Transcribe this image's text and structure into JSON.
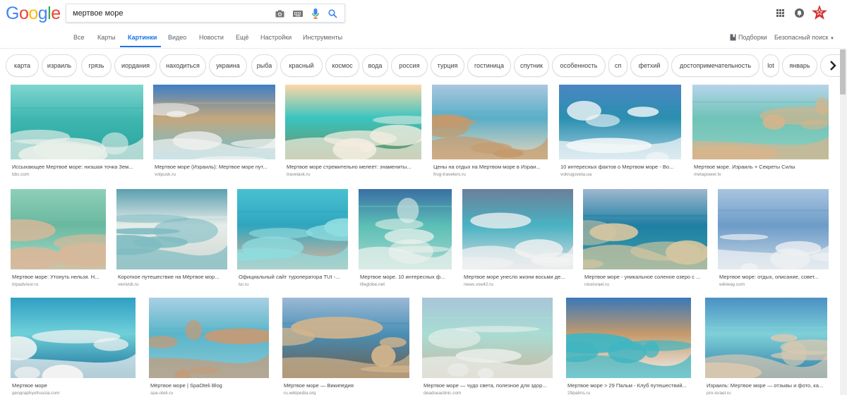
{
  "logo": {
    "letters": [
      "G",
      "o",
      "o",
      "g",
      "l",
      "e"
    ],
    "colors": [
      "#4285f4",
      "#ea4335",
      "#fbbc05",
      "#4285f4",
      "#34a853",
      "#ea4335"
    ]
  },
  "search": {
    "value": "мертвое море",
    "placeholder": ""
  },
  "icons": {
    "camera": "camera-icon",
    "keyboard": "keyboard-icon",
    "mic": "mic-icon",
    "search": "search-icon",
    "apps": "apps-grid-icon",
    "notifications": "notifications-icon",
    "profile": "star-profile-icon"
  },
  "nav": {
    "items": [
      {
        "label": "Все"
      },
      {
        "label": "Карты"
      },
      {
        "label": "Картинки"
      },
      {
        "label": "Видео"
      },
      {
        "label": "Новости"
      },
      {
        "label": "Ещё"
      },
      {
        "label": "Настройки"
      },
      {
        "label": "Инструменты"
      }
    ],
    "active": "Картинки",
    "collections": "Подборки",
    "safe_search": "Безопасный поиск"
  },
  "chips": [
    "карта",
    "израиль",
    "грязь",
    "иордания",
    "находиться",
    "украина",
    "рыба",
    "красный",
    "космос",
    "вода",
    "россия",
    "турция",
    "гостиница",
    "спутник",
    "особенность",
    "сп",
    "фетхий",
    "достопримечательность",
    "lot",
    "январь"
  ],
  "results": [
    {
      "caption": "Иссыхающее Мертвое море: низшая точка Зем...",
      "source": "bbc.com",
      "palette": [
        "#7fd6cf",
        "#3fb7b0",
        "#e8efe9",
        "#2aa29e"
      ]
    },
    {
      "caption": "Мертвое море (Израиль): Мертвое море пут...",
      "source": "votpusk.ru",
      "palette": [
        "#3f7fc4",
        "#c4a77d",
        "#f2f2f0",
        "#6ec0d3"
      ]
    },
    {
      "caption": "Мертвое море стремительно мелеет: знамениты...",
      "source": "travelask.ru",
      "palette": [
        "#ffd7a8",
        "#39c4c0",
        "#f3ede0",
        "#6f8f5f"
      ]
    },
    {
      "caption": "Цены на отдых на Мертвом море в Израи...",
      "source": "frog-travelers.ru",
      "palette": [
        "#a9c7de",
        "#5aaec8",
        "#c49a6c",
        "#e8d6bb"
      ]
    },
    {
      "caption": "10 интересных фактов о Мертвом море - Во...",
      "source": "vokrugsveta.ua",
      "palette": [
        "#4b86c2",
        "#2b8fb0",
        "#f4f7f8",
        "#a3cfe0"
      ]
    },
    {
      "caption": "Мертвое море. Израиль + Секреты Силы",
      "source": "metapower.tv",
      "palette": [
        "#b7d4ea",
        "#6fc3b8",
        "#d8b48a",
        "#8fcfc0"
      ]
    },
    {
      "caption": "Мертвое море: Утонуть нельзя. Н...",
      "source": "tripadvisor.ru",
      "palette": [
        "#8fcfb8",
        "#6ab8a0",
        "#d8b89a",
        "#a8dcc8"
      ]
    },
    {
      "caption": "Короткое путешествие на Мёртвое мор...",
      "source": "venividi.ru",
      "palette": [
        "#5a9fb0",
        "#e6ece8",
        "#7fbcc2",
        "#cfd8d4"
      ]
    },
    {
      "caption": "Официальный сайт туроператора TUI -...",
      "source": "tui.ru",
      "palette": [
        "#49c0d1",
        "#2fa6be",
        "#8fdde0",
        "#e7b59b"
      ]
    },
    {
      "caption": "Мертвое море. 10 интересных ф...",
      "source": "lifeglobe.net",
      "palette": [
        "#3a6fa4",
        "#5bbfb5",
        "#eef2ee",
        "#a8d8d0"
      ]
    },
    {
      "caption": "Мертвое море унесло жизни восьми де...",
      "source": "news.vse42.ru",
      "palette": [
        "#6c7f9a",
        "#49b2c2",
        "#f2f2f2",
        "#d9dde0"
      ]
    },
    {
      "caption": "Мертвое море - уникальное соленое озеро с ...",
      "source": "niceisrael.ru",
      "palette": [
        "#9fb8cf",
        "#1f7fa3",
        "#d6c6a0",
        "#3aa0a8"
      ]
    },
    {
      "caption": "Мертвое море: отдых, описание, совет...",
      "source": "wikiway.com",
      "palette": [
        "#a9c4df",
        "#6d9cc8",
        "#f0f2f4",
        "#c7d6e4"
      ]
    },
    {
      "caption": "Мертвое море",
      "source": "geographyofrussia.com",
      "palette": [
        "#2f9fc4",
        "#6fd0d8",
        "#f4f4f2",
        "#1a6f9a"
      ]
    },
    {
      "caption": "Мёртвое море | SpaOteli Blog",
      "source": "spa-oteli.ru",
      "palette": [
        "#a9d0e4",
        "#5ab5c9",
        "#c49a78",
        "#89c9d8"
      ]
    },
    {
      "caption": "Мёртвое море — Википедия",
      "source": "ru.wikipedia.org",
      "palette": [
        "#9cb9d6",
        "#4a8fb5",
        "#d2b48c",
        "#6b5b4a"
      ]
    },
    {
      "caption": "Мертвое море — чудо света, полезное для здор...",
      "source": "deadseaclinic.com",
      "palette": [
        "#a8c6d8",
        "#a8dcd4",
        "#ecf0ec",
        "#c9b8a0"
      ]
    },
    {
      "caption": "Мертвое море > 29 Пальм - Клуб путешествий...",
      "source": "29palms.ru",
      "palette": [
        "#3a78b8",
        "#c49a6c",
        "#3fb6c2",
        "#f2f2f0"
      ]
    },
    {
      "caption": "Израиль: Мертвое море — отзывы и фото, ка...",
      "source": "pro-israel.ru",
      "palette": [
        "#4a90c4",
        "#7fd0d8",
        "#d8c8b0",
        "#2f7fa8"
      ]
    }
  ]
}
